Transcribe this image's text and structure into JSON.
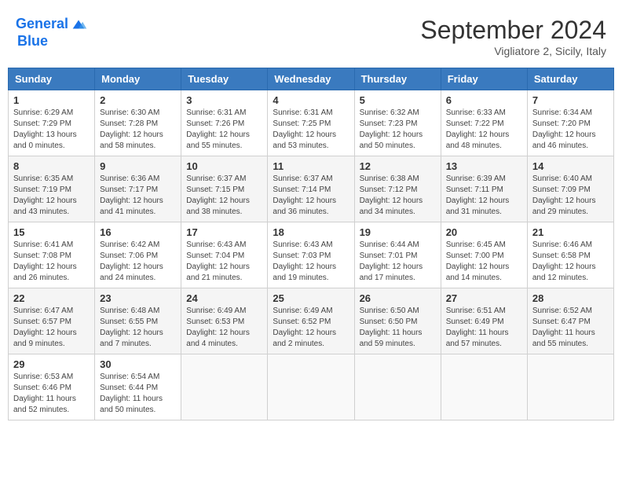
{
  "header": {
    "logo_line1": "General",
    "logo_line2": "Blue",
    "month_title": "September 2024",
    "subtitle": "Vigliatore 2, Sicily, Italy"
  },
  "weekdays": [
    "Sunday",
    "Monday",
    "Tuesday",
    "Wednesday",
    "Thursday",
    "Friday",
    "Saturday"
  ],
  "weeks": [
    [
      {
        "day": "1",
        "info": "Sunrise: 6:29 AM\nSunset: 7:29 PM\nDaylight: 13 hours\nand 0 minutes."
      },
      {
        "day": "2",
        "info": "Sunrise: 6:30 AM\nSunset: 7:28 PM\nDaylight: 12 hours\nand 58 minutes."
      },
      {
        "day": "3",
        "info": "Sunrise: 6:31 AM\nSunset: 7:26 PM\nDaylight: 12 hours\nand 55 minutes."
      },
      {
        "day": "4",
        "info": "Sunrise: 6:31 AM\nSunset: 7:25 PM\nDaylight: 12 hours\nand 53 minutes."
      },
      {
        "day": "5",
        "info": "Sunrise: 6:32 AM\nSunset: 7:23 PM\nDaylight: 12 hours\nand 50 minutes."
      },
      {
        "day": "6",
        "info": "Sunrise: 6:33 AM\nSunset: 7:22 PM\nDaylight: 12 hours\nand 48 minutes."
      },
      {
        "day": "7",
        "info": "Sunrise: 6:34 AM\nSunset: 7:20 PM\nDaylight: 12 hours\nand 46 minutes."
      }
    ],
    [
      {
        "day": "8",
        "info": "Sunrise: 6:35 AM\nSunset: 7:19 PM\nDaylight: 12 hours\nand 43 minutes."
      },
      {
        "day": "9",
        "info": "Sunrise: 6:36 AM\nSunset: 7:17 PM\nDaylight: 12 hours\nand 41 minutes."
      },
      {
        "day": "10",
        "info": "Sunrise: 6:37 AM\nSunset: 7:15 PM\nDaylight: 12 hours\nand 38 minutes."
      },
      {
        "day": "11",
        "info": "Sunrise: 6:37 AM\nSunset: 7:14 PM\nDaylight: 12 hours\nand 36 minutes."
      },
      {
        "day": "12",
        "info": "Sunrise: 6:38 AM\nSunset: 7:12 PM\nDaylight: 12 hours\nand 34 minutes."
      },
      {
        "day": "13",
        "info": "Sunrise: 6:39 AM\nSunset: 7:11 PM\nDaylight: 12 hours\nand 31 minutes."
      },
      {
        "day": "14",
        "info": "Sunrise: 6:40 AM\nSunset: 7:09 PM\nDaylight: 12 hours\nand 29 minutes."
      }
    ],
    [
      {
        "day": "15",
        "info": "Sunrise: 6:41 AM\nSunset: 7:08 PM\nDaylight: 12 hours\nand 26 minutes."
      },
      {
        "day": "16",
        "info": "Sunrise: 6:42 AM\nSunset: 7:06 PM\nDaylight: 12 hours\nand 24 minutes."
      },
      {
        "day": "17",
        "info": "Sunrise: 6:43 AM\nSunset: 7:04 PM\nDaylight: 12 hours\nand 21 minutes."
      },
      {
        "day": "18",
        "info": "Sunrise: 6:43 AM\nSunset: 7:03 PM\nDaylight: 12 hours\nand 19 minutes."
      },
      {
        "day": "19",
        "info": "Sunrise: 6:44 AM\nSunset: 7:01 PM\nDaylight: 12 hours\nand 17 minutes."
      },
      {
        "day": "20",
        "info": "Sunrise: 6:45 AM\nSunset: 7:00 PM\nDaylight: 12 hours\nand 14 minutes."
      },
      {
        "day": "21",
        "info": "Sunrise: 6:46 AM\nSunset: 6:58 PM\nDaylight: 12 hours\nand 12 minutes."
      }
    ],
    [
      {
        "day": "22",
        "info": "Sunrise: 6:47 AM\nSunset: 6:57 PM\nDaylight: 12 hours\nand 9 minutes."
      },
      {
        "day": "23",
        "info": "Sunrise: 6:48 AM\nSunset: 6:55 PM\nDaylight: 12 hours\nand 7 minutes."
      },
      {
        "day": "24",
        "info": "Sunrise: 6:49 AM\nSunset: 6:53 PM\nDaylight: 12 hours\nand 4 minutes."
      },
      {
        "day": "25",
        "info": "Sunrise: 6:49 AM\nSunset: 6:52 PM\nDaylight: 12 hours\nand 2 minutes."
      },
      {
        "day": "26",
        "info": "Sunrise: 6:50 AM\nSunset: 6:50 PM\nDaylight: 11 hours\nand 59 minutes."
      },
      {
        "day": "27",
        "info": "Sunrise: 6:51 AM\nSunset: 6:49 PM\nDaylight: 11 hours\nand 57 minutes."
      },
      {
        "day": "28",
        "info": "Sunrise: 6:52 AM\nSunset: 6:47 PM\nDaylight: 11 hours\nand 55 minutes."
      }
    ],
    [
      {
        "day": "29",
        "info": "Sunrise: 6:53 AM\nSunset: 6:46 PM\nDaylight: 11 hours\nand 52 minutes."
      },
      {
        "day": "30",
        "info": "Sunrise: 6:54 AM\nSunset: 6:44 PM\nDaylight: 11 hours\nand 50 minutes."
      },
      {
        "day": "",
        "info": ""
      },
      {
        "day": "",
        "info": ""
      },
      {
        "day": "",
        "info": ""
      },
      {
        "day": "",
        "info": ""
      },
      {
        "day": "",
        "info": ""
      }
    ]
  ]
}
